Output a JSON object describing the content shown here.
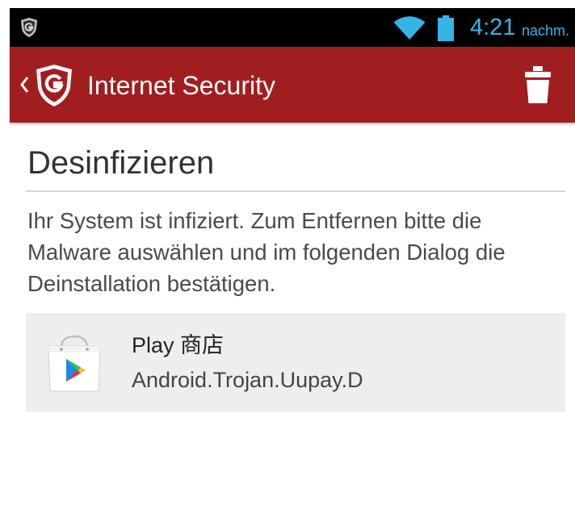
{
  "status_bar": {
    "time": "4:21",
    "ampm": "nachm.",
    "icons": [
      "gdata-shield-icon",
      "wifi-icon",
      "battery-icon"
    ],
    "accent_color": "#33b5e5"
  },
  "action_bar": {
    "title": "Internet Security",
    "back_icon": "back-chevron-icon",
    "logo_icon": "gdata-shield-logo-icon",
    "action_icon": "trash-icon",
    "background_color": "#a01e20"
  },
  "content": {
    "heading": "Desinfizieren",
    "description": "Ihr System ist infiziert. Zum Entfernen bitte die Malware auswählen und im folgenden Dialog die Deinstallation bestätigen.",
    "malware_items": [
      {
        "app_name": "Play 商店",
        "threat_name": "Android.Trojan.Uupay.D",
        "icon": "play-store-icon"
      }
    ]
  }
}
